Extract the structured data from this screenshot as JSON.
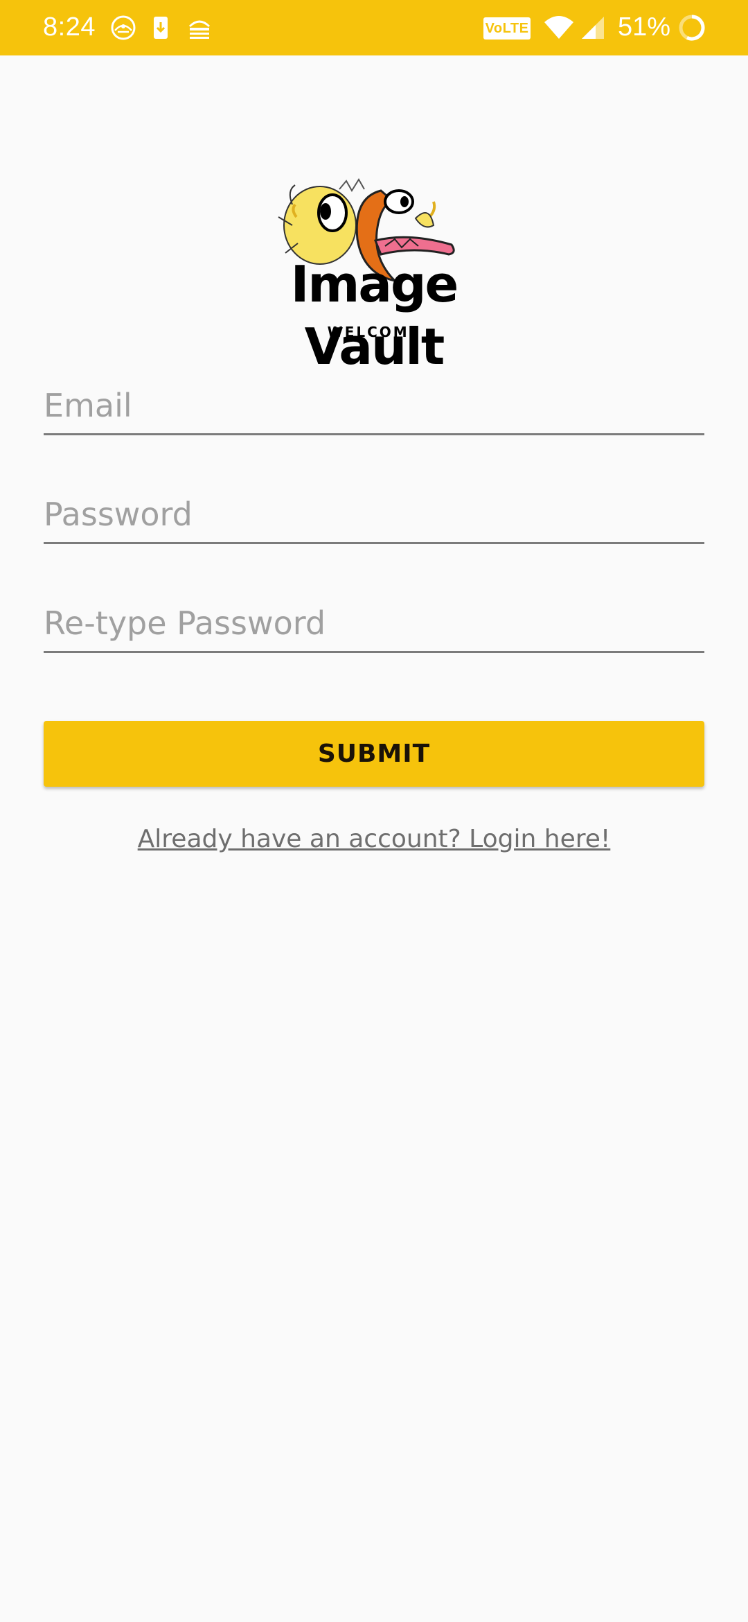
{
  "status_bar": {
    "time": "8:24",
    "volte": "VoLTE",
    "battery_percent": "51%",
    "icons": [
      "compass-notification-icon",
      "phone-download-icon",
      "vpn-key-icon",
      "wifi-icon",
      "cell-signal-icon",
      "battery-charging-icon"
    ]
  },
  "logo": {
    "title": "Image Vault",
    "subtitle": "WELCOME"
  },
  "form": {
    "email_placeholder": "Email",
    "password_placeholder": "Password",
    "retype_placeholder": "Re-type Password",
    "submit_label": "SUBMIT",
    "login_link": "Already have an account? Login here!"
  },
  "colors": {
    "accent": "#f6c30c",
    "background": "#fafafa",
    "underline": "#7b7b7b",
    "placeholder": "#a0a0a0"
  }
}
